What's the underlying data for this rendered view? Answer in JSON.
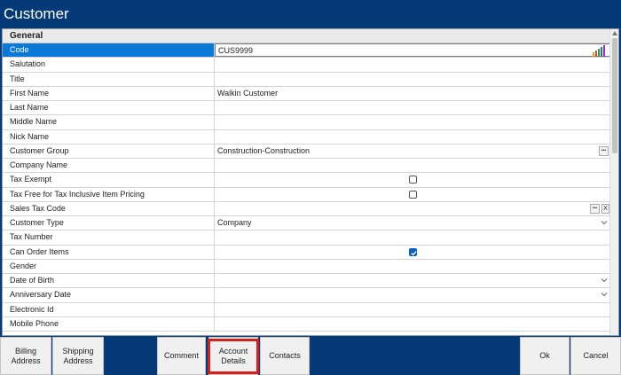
{
  "window": {
    "title": "Customer"
  },
  "section": {
    "title": "General"
  },
  "fields": [
    {
      "label": "Code",
      "value": "CUS9999",
      "kind": "text",
      "selected": true,
      "icons": [
        "lock-icon",
        "chart-icon"
      ]
    },
    {
      "label": "Salutation",
      "value": "",
      "kind": "text"
    },
    {
      "label": "Title",
      "value": "",
      "kind": "text"
    },
    {
      "label": "First Name",
      "value": "Walkin Customer",
      "kind": "text"
    },
    {
      "label": "Last Name",
      "value": "",
      "kind": "text"
    },
    {
      "label": "Middle Name",
      "value": "",
      "kind": "text"
    },
    {
      "label": "Nick Name",
      "value": "",
      "kind": "text"
    },
    {
      "label": "Customer Group",
      "value": "Construction-Construction",
      "kind": "lookup",
      "icons": [
        "ellipsis-icon"
      ]
    },
    {
      "label": "Company Name",
      "value": "",
      "kind": "text"
    },
    {
      "label": "Tax Exempt",
      "value": "",
      "kind": "checkbox",
      "checked": false
    },
    {
      "label": "Tax Free for Tax Inclusive Item Pricing",
      "value": "",
      "kind": "checkbox",
      "checked": false
    },
    {
      "label": "Sales Tax Code",
      "value": "",
      "kind": "lookup-clear",
      "icons": [
        "ellipsis-icon",
        "clear-icon"
      ],
      "clear_label": "X"
    },
    {
      "label": "Customer Type",
      "value": "Company",
      "kind": "dropdown",
      "icons": [
        "chevron-down-icon"
      ]
    },
    {
      "label": "Tax Number",
      "value": "",
      "kind": "text"
    },
    {
      "label": "Can Order Items",
      "value": "",
      "kind": "checkbox",
      "checked": true
    },
    {
      "label": "Gender",
      "value": "",
      "kind": "text"
    },
    {
      "label": "Date of Birth",
      "value": "",
      "kind": "dropdown",
      "icons": [
        "chevron-down-icon"
      ]
    },
    {
      "label": "Anniversary Date",
      "value": "",
      "kind": "dropdown",
      "icons": [
        "chevron-down-icon"
      ]
    },
    {
      "label": "Electronic Id",
      "value": "",
      "kind": "text"
    },
    {
      "label": "Mobile Phone",
      "value": "",
      "kind": "text"
    }
  ],
  "footer": {
    "billing_address": "Billing Address",
    "shipping_address": "Shipping Address",
    "comment": "Comment",
    "account_details": "Account Details",
    "contacts": "Contacts",
    "ok": "Ok",
    "cancel": "Cancel"
  },
  "colors": {
    "brand_blue": "#053a78",
    "selection_blue": "#0a78d7",
    "highlight_red": "#d42020"
  }
}
